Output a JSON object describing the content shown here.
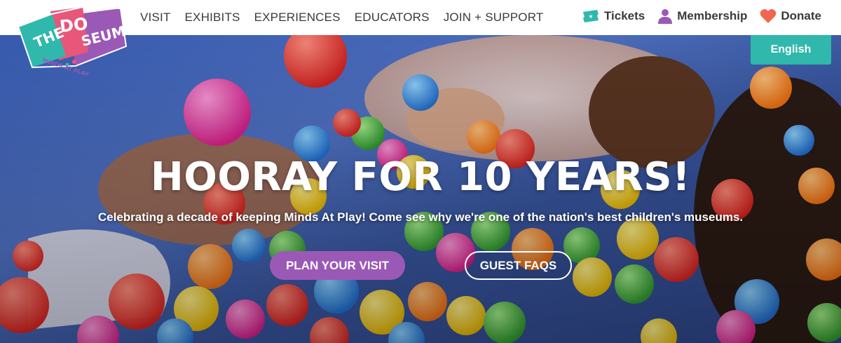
{
  "logo": {
    "line1": "THE",
    "line2": "DO",
    "line3": "SEUM",
    "tagline": "MINDS AT PLAY",
    "colors": {
      "teal": "#2fb8ab",
      "pink": "#e8567a",
      "purple": "#9b59b6"
    }
  },
  "nav": {
    "items": [
      {
        "label": "VISIT"
      },
      {
        "label": "EXHIBITS"
      },
      {
        "label": "EXPERIENCES"
      },
      {
        "label": "EDUCATORS"
      },
      {
        "label": "JOIN + SUPPORT"
      }
    ]
  },
  "utility": {
    "tickets": {
      "label": "Tickets",
      "icon": "ticket-icon",
      "color": "#2fb8ab"
    },
    "membership": {
      "label": "Membership",
      "icon": "person-icon",
      "color": "#9b59b6"
    },
    "donate": {
      "label": "Donate",
      "icon": "heart-icon",
      "color": "#f0664f"
    }
  },
  "language": {
    "label": "English"
  },
  "hero": {
    "title": "HOORAY FOR 10 YEARS!",
    "subtitle": "Celebrating a decade of keeping Minds At Play! Come see why we're one of the nation's best children's museums.",
    "primary_cta": "PLAN YOUR VISIT",
    "secondary_cta": "GUEST FAQS"
  },
  "colors": {
    "accent_teal": "#2fb8ab",
    "accent_purple": "#9b59b6",
    "nav_text": "#3a3a3a"
  }
}
